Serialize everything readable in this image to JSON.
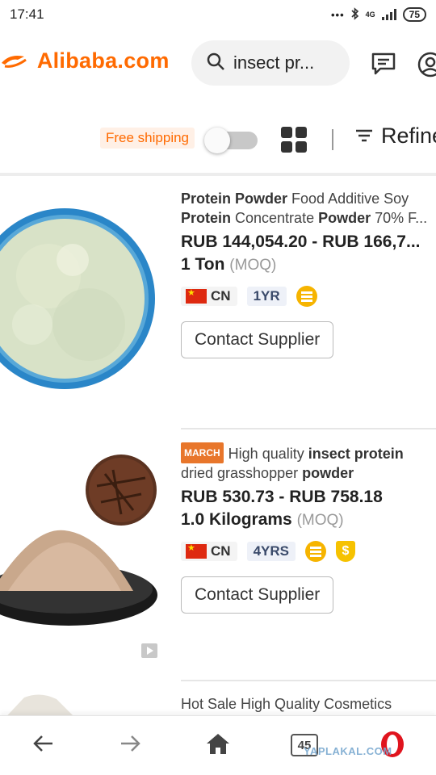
{
  "status_bar": {
    "time": "17:41",
    "network": "4G",
    "battery": "75"
  },
  "header": {
    "logo_text": "Alibaba.com",
    "search_text": "insect pr..."
  },
  "filters": {
    "free_shipping": "Free shipping",
    "free_shipping_enabled": false,
    "refine_label": "Refine"
  },
  "products": [
    {
      "title_parts": [
        {
          "text": "Protein Powder",
          "bold": true
        },
        {
          "text": " Food Additive Soy ",
          "bold": false
        },
        {
          "text": "Protein",
          "bold": true
        },
        {
          "text": " Concentrate ",
          "bold": false
        },
        {
          "text": "Powder",
          "bold": true
        },
        {
          "text": " 70% F...",
          "bold": false
        }
      ],
      "price": "RUB 144,054.20 - RUB 166,7...",
      "moq_value": "1 Ton",
      "moq_label": "(MOQ)",
      "country": "CN",
      "years": "1YR",
      "contact_label": "Contact Supplier"
    },
    {
      "badge": "MARCH",
      "title_parts": [
        {
          "text": "High quality ",
          "bold": false
        },
        {
          "text": "insect protein",
          "bold": true
        }
      ],
      "title_line2_parts": [
        {
          "text": "dried grasshopper ",
          "bold": false
        },
        {
          "text": "powder",
          "bold": true
        }
      ],
      "price": "RUB 530.73 - RUB 758.18",
      "moq_value": "1.0 Kilograms",
      "moq_label": "(MOQ)",
      "country": "CN",
      "years": "4YRS",
      "contact_label": "Contact Supplier"
    },
    {
      "title": "Hot Sale High Quality Cosmetics"
    }
  ],
  "bottom_nav": {
    "tabs_count": "45",
    "watermark": "YAPLAKAL.COM"
  },
  "colors": {
    "accent": "#ff6a00",
    "opera_red": "#e0141e",
    "gold": "#f6b400"
  }
}
